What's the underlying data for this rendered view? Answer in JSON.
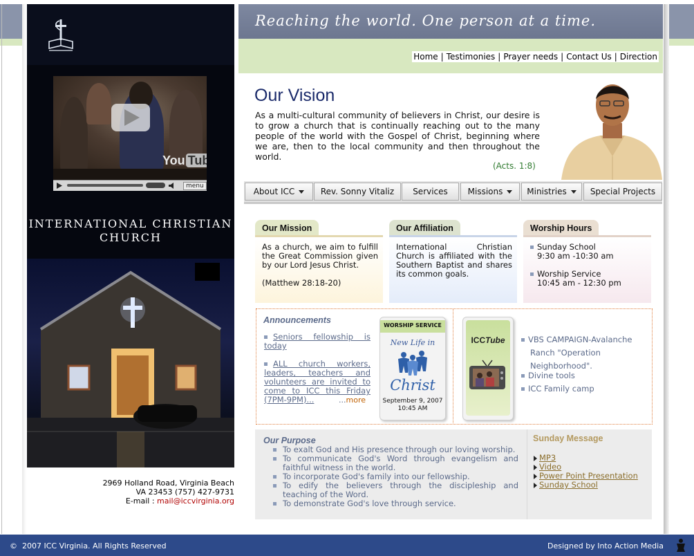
{
  "header": {
    "tagline": "Reaching the world. One person at a time.",
    "top_links": [
      "Home",
      "Testimonies",
      "Prayer needs",
      "Contact Us",
      "Direction"
    ]
  },
  "video": {
    "brand": "You",
    "brand_tube": "Tube",
    "menu_label": "menu"
  },
  "church": {
    "name_line1": "INTERNATIONAL CHRISTIAN",
    "name_line2": "CHURCH"
  },
  "address": {
    "line1": "2969 Holland Road, Virginia Beach",
    "line2": "VA 23453 (757) 427-9731",
    "email_label": "E-mail : ",
    "email": "mail@iccvirginia.org"
  },
  "vision": {
    "title": "Our Vision",
    "text": "As a multi-cultural community of believers in Christ, our desire is to grow a church that is continually reaching out to the many people of the world with the Gospel of Christ, beginning where we are, then to the local community and then throughout the world.",
    "reference": "(Acts. 1:8)"
  },
  "menu": [
    {
      "label": "About ICC",
      "dropdown": true
    },
    {
      "label": "Rev. Sonny Vitaliz",
      "dropdown": false
    },
    {
      "label": "Services",
      "dropdown": false
    },
    {
      "label": "Missions",
      "dropdown": true
    },
    {
      "label": "Ministries",
      "dropdown": true
    },
    {
      "label": "Special Projects",
      "dropdown": false
    }
  ],
  "mission": {
    "title": "Our Mission",
    "text": "As a church, we aim to fulfill the Great Commission given by our Lord Jesus Christ.",
    "verse": "(Matthew 28:18-20)"
  },
  "affiliation": {
    "title": "Our Affiliation",
    "text": "International Christian Church is affiliated with the Southern Baptist and shares its common goals."
  },
  "worship_hours": {
    "title": "Worship Hours",
    "item1_name": "Sunday School",
    "item1_time": "9:30 am -10:30 am",
    "item2_name": "Worship Service",
    "item2_time": "10:45 am - 12:30 pm"
  },
  "announcements": {
    "title": "Announcements",
    "item1": "Seniors fellowship is today",
    "item2": "ALL church workers, leaders, teachers and volunteers are invited to come to ICC this Friday (7PM-9PM)...",
    "more_prefix": "...",
    "more": "more"
  },
  "poster": {
    "header": "WORSHIP SERVICE",
    "title_line1": "New Life in",
    "title_line2": "Christ",
    "date": "September 9, 2007",
    "time": "10:45 AM"
  },
  "icc_tube": {
    "label_icc": "ICC",
    "label_tube": "Tube"
  },
  "events": {
    "item1_line1": "VBS CAMPAIGN-Avalanche",
    "item1_line2": "Ranch \"Operation",
    "item1_line3": "Neighborhood\".",
    "item2": "Divine tools",
    "item3": "ICC Family camp"
  },
  "purpose": {
    "title": "Our Purpose",
    "items": [
      "To exalt God and His presence through our loving worship.",
      "To communicate God's Word through evangelism and faithful witness in the world.",
      "To incorporate God's family into our fellowship.",
      "To edify the believers through the discipleship and teaching of the Word.",
      "To demonstrate God's love through service."
    ]
  },
  "sunday_message": {
    "title": "Sunday Message",
    "links": [
      "MP3",
      "Video",
      "Power Point Presentation",
      "Sunday School"
    ]
  },
  "footer": {
    "copyright": "©  2007 ICC Virginia. All Rights Reserved",
    "designer": "Designed by Into Action Media"
  },
  "colors": {
    "header_bg": "#7e88a0",
    "nav_bg": "#d8e8c0",
    "footer_bg": "#2d4a8a",
    "link_blue": "#5b6a8a",
    "vision_title": "#1a2a6a",
    "dotted_border": "#e08040"
  },
  "icons": [
    "cross-book-logo-icon",
    "play-icon",
    "volume-icon",
    "dropdown-caret-icon",
    "square-bullet-icon",
    "arrow-bullet-icon",
    "tv-icon",
    "designer-logo-icon"
  ]
}
